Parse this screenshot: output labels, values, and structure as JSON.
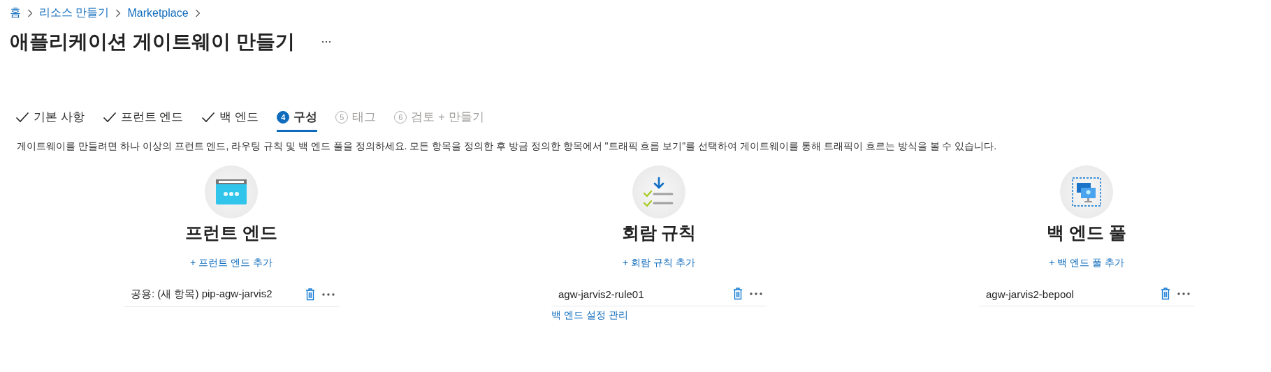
{
  "breadcrumb": [
    "홈",
    "리소스 만들기",
    "Marketplace"
  ],
  "title": "애플리케이션 게이트웨이 만들기",
  "tabs": [
    {
      "label": "기본 사항",
      "kind": "done",
      "selected": false
    },
    {
      "label": "프런트 엔드",
      "kind": "done",
      "selected": false
    },
    {
      "label": "백 엔드",
      "kind": "done",
      "selected": false
    },
    {
      "label": "구성",
      "kind": "step",
      "number": "4",
      "selected": true
    },
    {
      "label": "태그",
      "kind": "step",
      "number": "5",
      "selected": false
    },
    {
      "label": "검토 + 만들기",
      "kind": "step",
      "number": "6",
      "selected": false
    }
  ],
  "description": "게이트웨이를 만들려면 하나 이상의 프런트 엔드, 라우팅 규칙 및 백 엔드 풀을 정의하세요. 모든 항목을 정의한 후 방금 정의한 항목에서 \"트래픽 흐름 보기\"를 선택하여 게이트웨이를 통해 트래픽이 흐르는 방식을 볼 수 있습니다.",
  "sections": [
    {
      "kind": "frontend",
      "title": "프런트 엔드",
      "add_link": "+ 프런트 엔드 추가",
      "items": [
        {
          "name": "공용: (새 항목) pip-agw-jarvis2"
        }
      ]
    },
    {
      "kind": "rules",
      "title": "회람 규칙",
      "add_link": "+ 회람 규칙 추가",
      "items": [
        {
          "name": "agw-jarvis2-rule01"
        }
      ],
      "footer_link": "백 엔드 설정 관리"
    },
    {
      "kind": "backend",
      "title": "백 엔드 풀",
      "add_link": "+ 백 엔드 풀 추가",
      "items": [
        {
          "name": "agw-jarvis2-bepool"
        }
      ]
    }
  ]
}
